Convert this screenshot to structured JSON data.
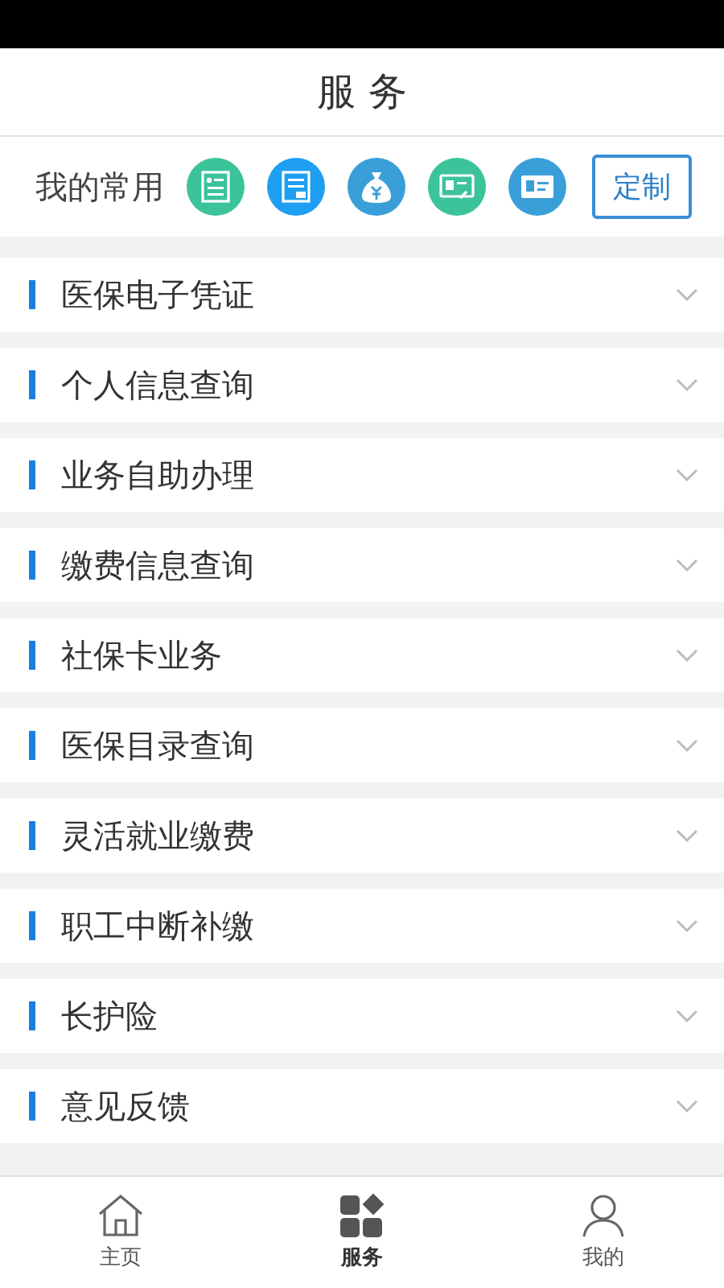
{
  "header": {
    "title": "服 务"
  },
  "favorites": {
    "label": "我的常用",
    "shortcuts": [
      {
        "kind": "form",
        "color": "#3cc39a"
      },
      {
        "kind": "document",
        "color": "#1e9ff2"
      },
      {
        "kind": "money",
        "color": "#3a9fd8"
      },
      {
        "kind": "card",
        "color": "#3cc39a"
      },
      {
        "kind": "idcard",
        "color": "#3a9fd8"
      }
    ],
    "customize": "定制"
  },
  "sections": [
    {
      "label": "医保电子凭证",
      "expanded": false
    },
    {
      "label": "个人信息查询",
      "expanded": false
    },
    {
      "label": "业务自助办理",
      "expanded": false
    },
    {
      "label": "缴费信息查询",
      "expanded": false
    },
    {
      "label": "社保卡业务",
      "expanded": false
    },
    {
      "label": "医保目录查询",
      "expanded": false
    },
    {
      "label": "灵活就业缴费",
      "expanded": false
    },
    {
      "label": "职工中断补缴",
      "expanded": false
    },
    {
      "label": "长护险",
      "expanded": false
    },
    {
      "label": "意见反馈",
      "expanded": false
    }
  ],
  "tabbar": [
    {
      "kind": "home",
      "label": "主页",
      "selected": false
    },
    {
      "kind": "grid",
      "label": "服务",
      "selected": true
    },
    {
      "kind": "person",
      "label": "我的",
      "selected": false
    }
  ]
}
